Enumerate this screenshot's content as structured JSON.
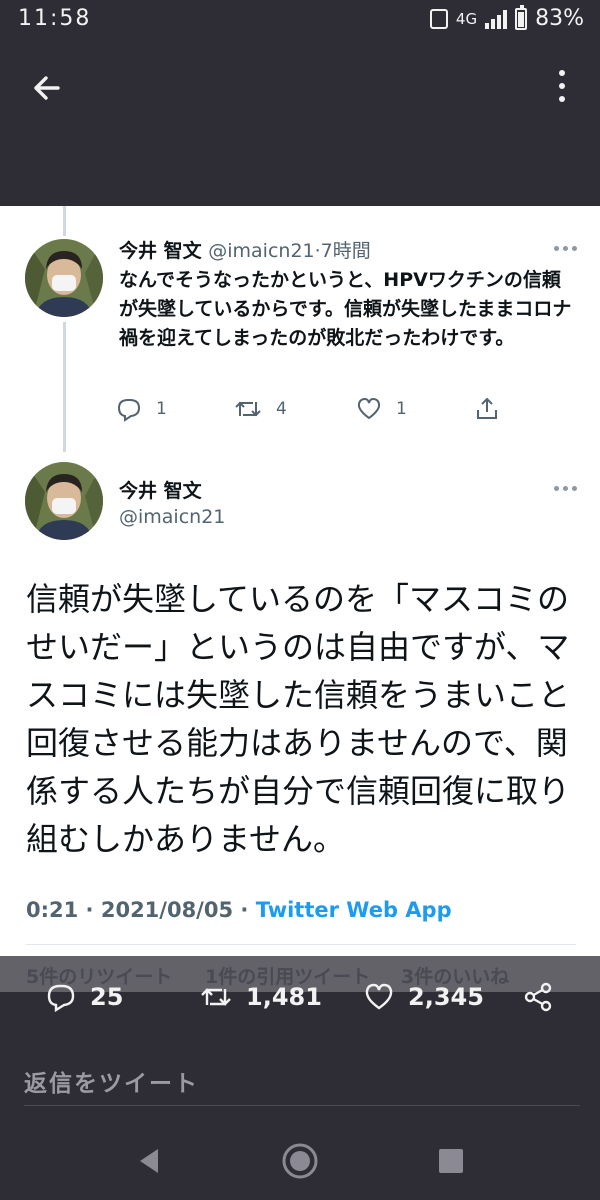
{
  "status_bar": {
    "time": "11:58",
    "network": "4G",
    "battery": "83%"
  },
  "reply_tweet": {
    "name": "今井 智文",
    "handle": "@imaicn21",
    "time": "·7時間",
    "text": "なんでそうなったかというと、HPVワクチンの信頼が失墜しているからです。信頼が失墜したままコロナ禍を迎えてしまったのが敗北だったわけです。",
    "replies": "1",
    "retweets": "4",
    "likes": "1"
  },
  "main_tweet": {
    "name": "今井 智文",
    "handle": "@imaicn21",
    "text": "信頼が失墜しているのを「マスコミのせいだー」というのは自由ですが、マスコミには失墜した信頼をうまいこと回復させる能力はありませんので、関係する人たちが自分で信頼回復に取り組むしかありません。",
    "time": "0:21",
    "sep1": " · ",
    "date": "2021/08/05",
    "sep2": " · ",
    "source": "Twitter Web App"
  },
  "stats": {
    "retweets": "5件のリツイート",
    "quotes": "1件の引用ツイート",
    "likes": "3件のいいね"
  },
  "bottom_actions": {
    "replies": "25",
    "retweets": "1,481",
    "likes": "2,345"
  },
  "reply_input": {
    "placeholder": "返信をツイート"
  },
  "icons": [
    "back-arrow-icon",
    "more-vertical-icon",
    "reply-icon",
    "retweet-icon",
    "like-icon",
    "share-icon",
    "nav-back-icon",
    "nav-home-icon",
    "nav-recents-icon"
  ]
}
